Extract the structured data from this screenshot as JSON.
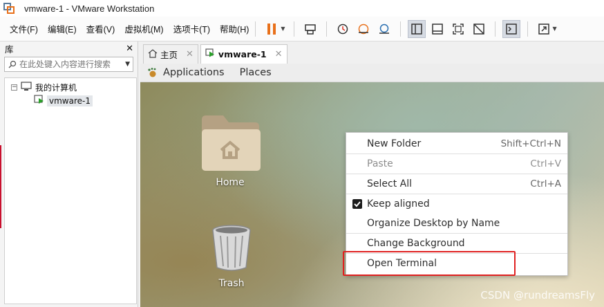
{
  "window": {
    "title": "vmware-1 - VMware Workstation"
  },
  "menubar": {
    "items": [
      {
        "label": "文件(F)"
      },
      {
        "label": "编辑(E)"
      },
      {
        "label": "查看(V)"
      },
      {
        "label": "虚拟机(M)"
      },
      {
        "label": "选项卡(T)"
      },
      {
        "label": "帮助(H)"
      }
    ]
  },
  "toolbar": {
    "icons": [
      "pause-icon",
      "send-keys-icon",
      "snapshot-icon",
      "revert-snapshot-icon",
      "snapshot-manager-icon",
      "library-view-icon",
      "console-view-icon",
      "fullscreen-icon",
      "unity-icon",
      "terminal-icon",
      "stretch-icon"
    ],
    "accent": "#e8701a"
  },
  "library": {
    "title": "库",
    "search_placeholder": "在此处键入内容进行搜索",
    "tree": {
      "root_label": "我的计算机",
      "children": [
        {
          "label": "vmware-1"
        }
      ]
    }
  },
  "tabs": [
    {
      "label": "主页"
    },
    {
      "label": "vmware-1"
    }
  ],
  "gnome": {
    "applications": "Applications",
    "places": "Places"
  },
  "desktop": {
    "icons": [
      {
        "label": "Home"
      },
      {
        "label": "Trash"
      }
    ]
  },
  "context_menu": {
    "items": [
      {
        "label": "New Folder",
        "accelerator": "Shift+Ctrl+N",
        "enabled": true
      },
      {
        "label": "Paste",
        "accelerator": "Ctrl+V",
        "enabled": false
      },
      {
        "label": "Select All",
        "accelerator": "Ctrl+A",
        "enabled": true
      },
      {
        "label": "Keep aligned",
        "accelerator": "",
        "enabled": true,
        "checked": true
      },
      {
        "label": "Organize Desktop by Name",
        "accelerator": "",
        "enabled": true
      },
      {
        "label": "Change Background",
        "accelerator": "",
        "enabled": true
      },
      {
        "label": "Open Terminal",
        "accelerator": "",
        "enabled": true,
        "highlighted_by_annotation": true
      }
    ],
    "annotation_color": "#e02020"
  },
  "watermark": "CSDN @rundreamsFly"
}
